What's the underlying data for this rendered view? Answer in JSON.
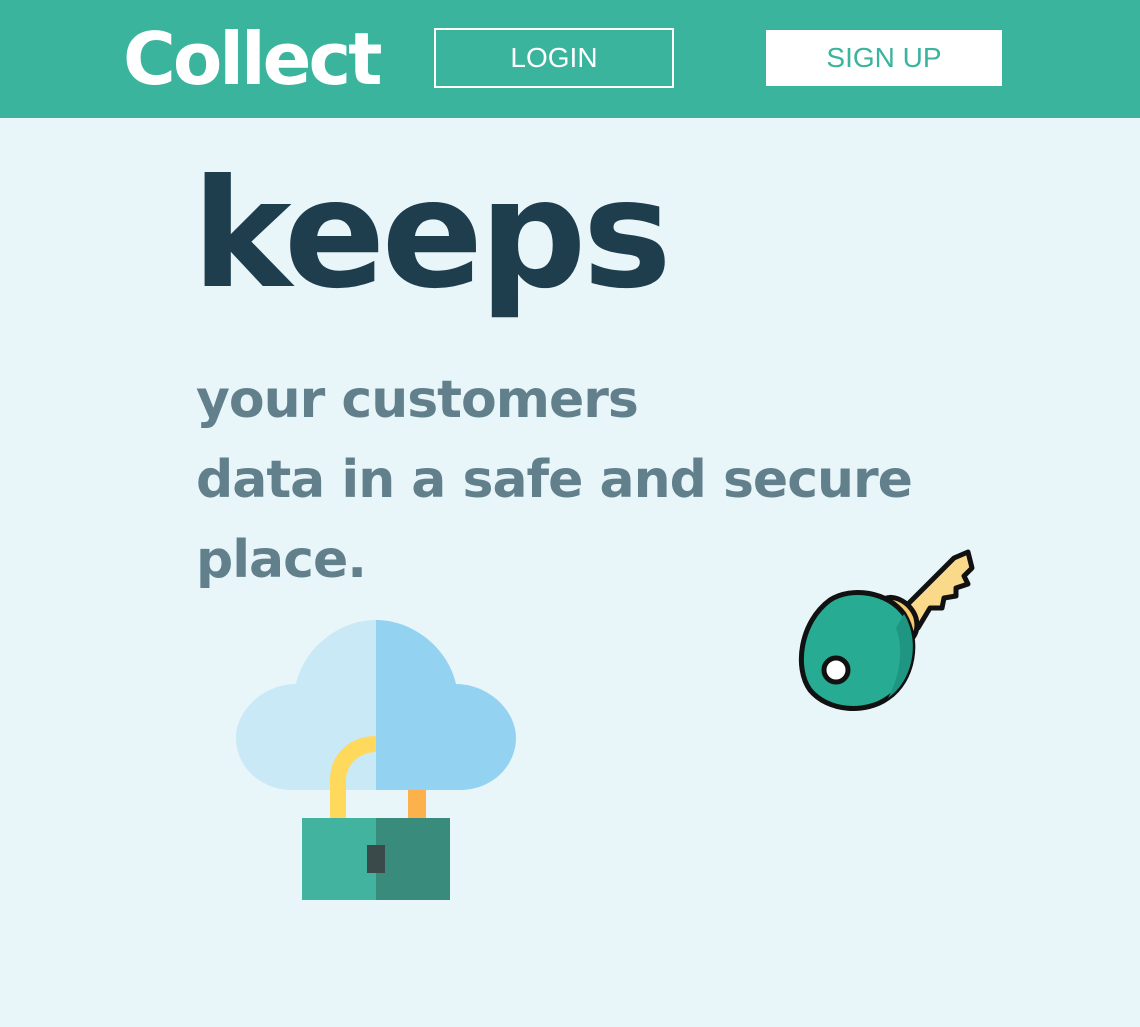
{
  "header": {
    "logo_text": "Collect",
    "login_label": "LOGIN",
    "signup_label": "SIGN UP"
  },
  "hero": {
    "headline": "keeps",
    "subtext_lines": [
      "your customers",
      "data in a safe and secure",
      "place."
    ]
  },
  "illustrations": {
    "cloud_lock_icon": "cloud-lock-icon",
    "key_icon": "key-icon"
  },
  "colors": {
    "header_bg": "#3ab49c",
    "page_bg": "#e8f5f9",
    "headline": "#1e3d4d",
    "subtext": "#62808c",
    "signup_text": "#3ab49c"
  }
}
